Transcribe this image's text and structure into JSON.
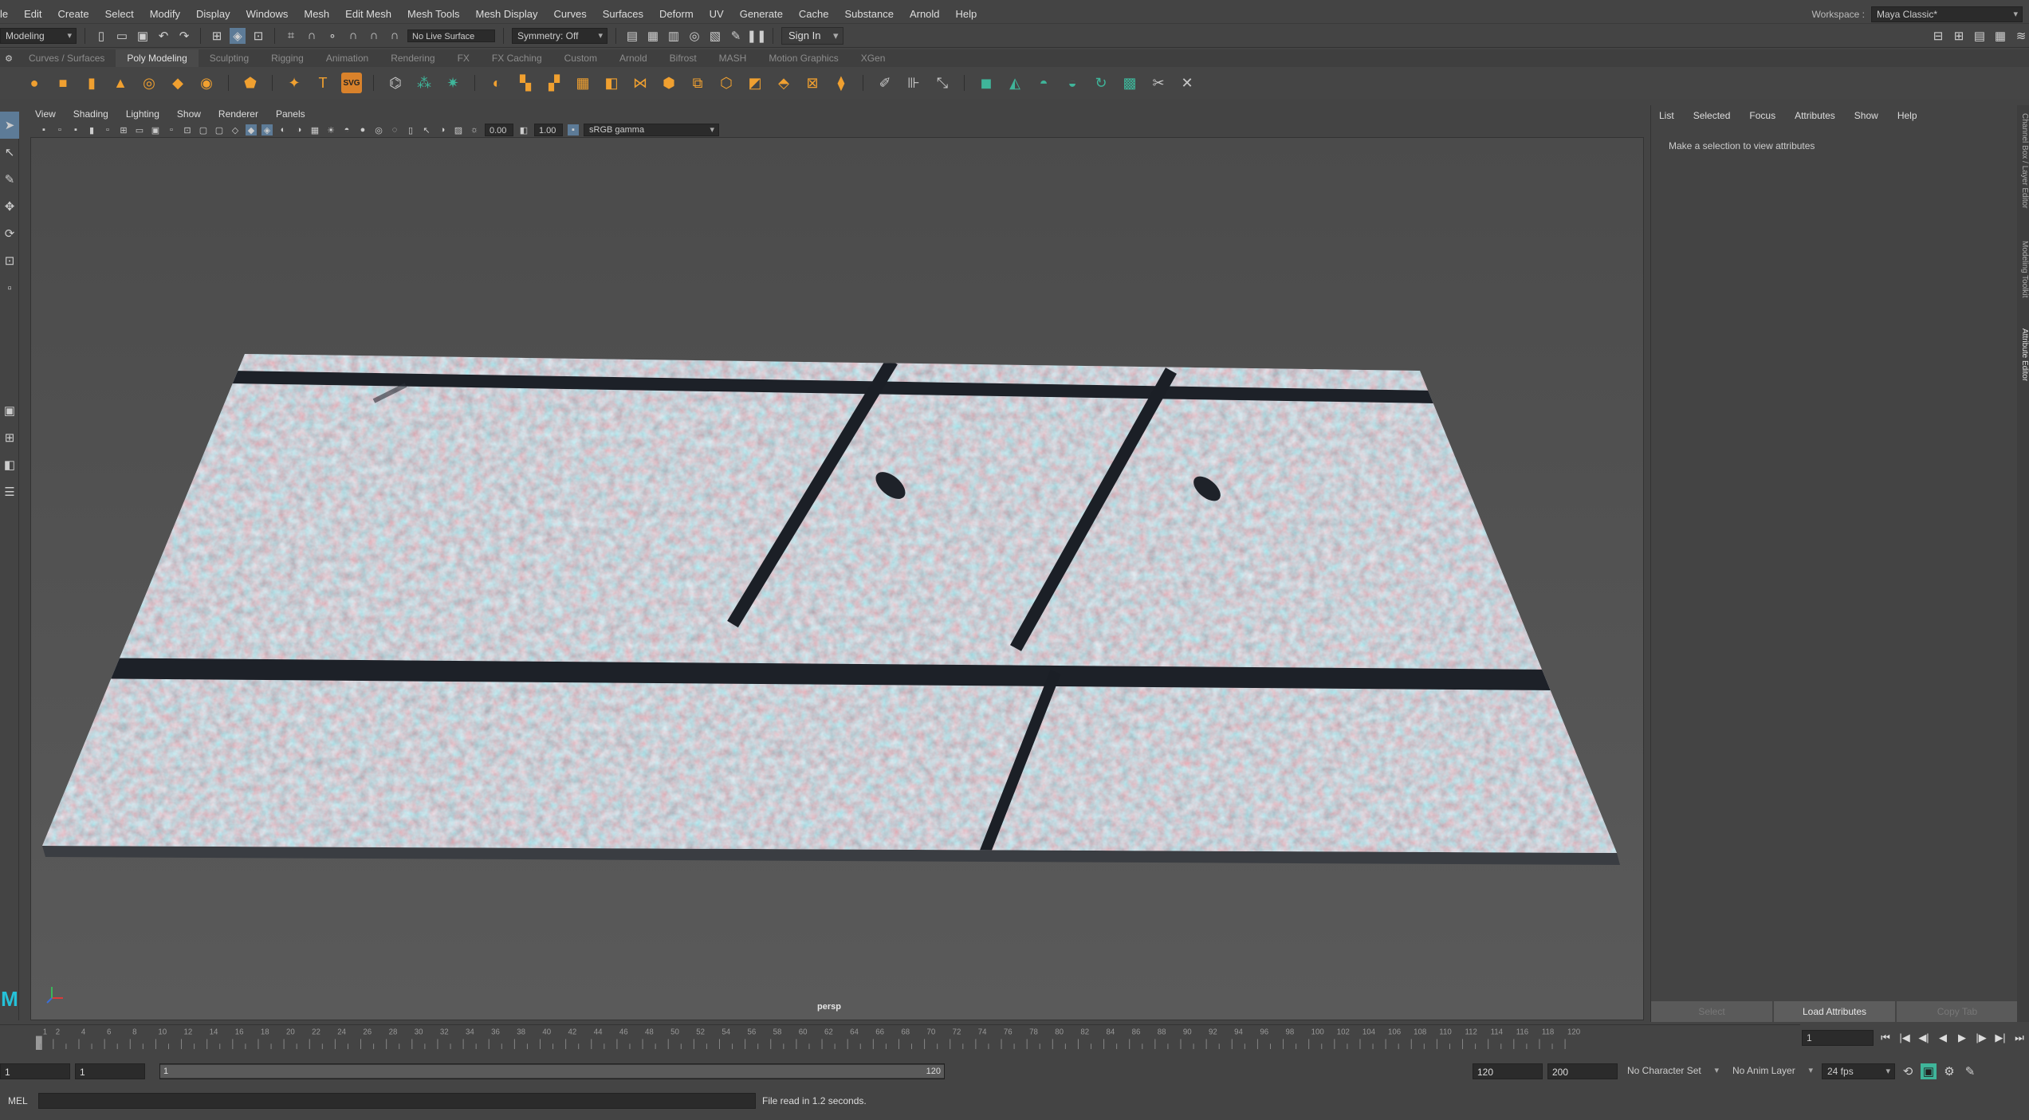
{
  "menubar": {
    "items": [
      "le",
      "Edit",
      "Create",
      "Select",
      "Modify",
      "Display",
      "Windows",
      "Mesh",
      "Edit Mesh",
      "Mesh Tools",
      "Mesh Display",
      "Curves",
      "Surfaces",
      "Deform",
      "UV",
      "Generate",
      "Cache",
      "Substance",
      "Arnold",
      "Help"
    ],
    "workspace_label": "Workspace :",
    "workspace_value": "Maya Classic*"
  },
  "statusline": {
    "mode": "Modeling",
    "live_surface": "No Live Surface",
    "symmetry": "Symmetry: Off",
    "sign_in": "Sign In"
  },
  "shelf": {
    "tabs": [
      "Curves / Surfaces",
      "Poly Modeling",
      "Sculpting",
      "Rigging",
      "Animation",
      "Rendering",
      "FX",
      "FX Caching",
      "Custom",
      "Arnold",
      "Bifrost",
      "MASH",
      "Motion Graphics",
      "XGen"
    ],
    "active_tab": "Poly Modeling",
    "svg_label": "SVG",
    "text_tool_label": "T"
  },
  "viewport": {
    "menu": [
      "View",
      "Shading",
      "Lighting",
      "Show",
      "Renderer",
      "Panels"
    ],
    "exposure": "0.00",
    "gamma": "1.00",
    "color_space": "sRGB gamma",
    "camera_label": "persp"
  },
  "attribute_editor": {
    "menu": [
      "List",
      "Selected",
      "Focus",
      "Attributes",
      "Show",
      "Help"
    ],
    "message": "Make a selection to view attributes",
    "buttons": [
      "Select",
      "Load Attributes",
      "Copy Tab"
    ],
    "side_tabs": [
      "Channel Box / Layer Editor",
      "Modeling Toolkit",
      "Attribute Editor"
    ]
  },
  "timeline": {
    "ticks": [
      "1",
      "2",
      "4",
      "6",
      "8",
      "10",
      "12",
      "14",
      "16",
      "18",
      "20",
      "22",
      "24",
      "26",
      "28",
      "30",
      "32",
      "34",
      "36",
      "38",
      "40",
      "42",
      "44",
      "46",
      "48",
      "50",
      "52",
      "54",
      "56",
      "58",
      "60",
      "62",
      "64",
      "66",
      "68",
      "70",
      "72",
      "74",
      "76",
      "78",
      "80",
      "82",
      "84",
      "86",
      "88",
      "90",
      "92",
      "94",
      "96",
      "98",
      "100",
      "102",
      "104",
      "106",
      "108",
      "110",
      "112",
      "114",
      "116",
      "118",
      "120"
    ],
    "current_frame": "1"
  },
  "range": {
    "start": "1",
    "playback_start": "1",
    "slider_start": "1",
    "slider_end": "120",
    "playback_end": "120",
    "end": "200",
    "character_set": "No Character Set",
    "anim_layer": "No Anim Layer",
    "fps": "24 fps"
  },
  "cmdline": {
    "label": "MEL",
    "output": "File read in  1.2 seconds."
  },
  "colors": {
    "accent": "#5d7b97",
    "shelf_orange": "#f0a030",
    "shelf_teal": "#3fb59a",
    "logo": "#25c1d8"
  }
}
